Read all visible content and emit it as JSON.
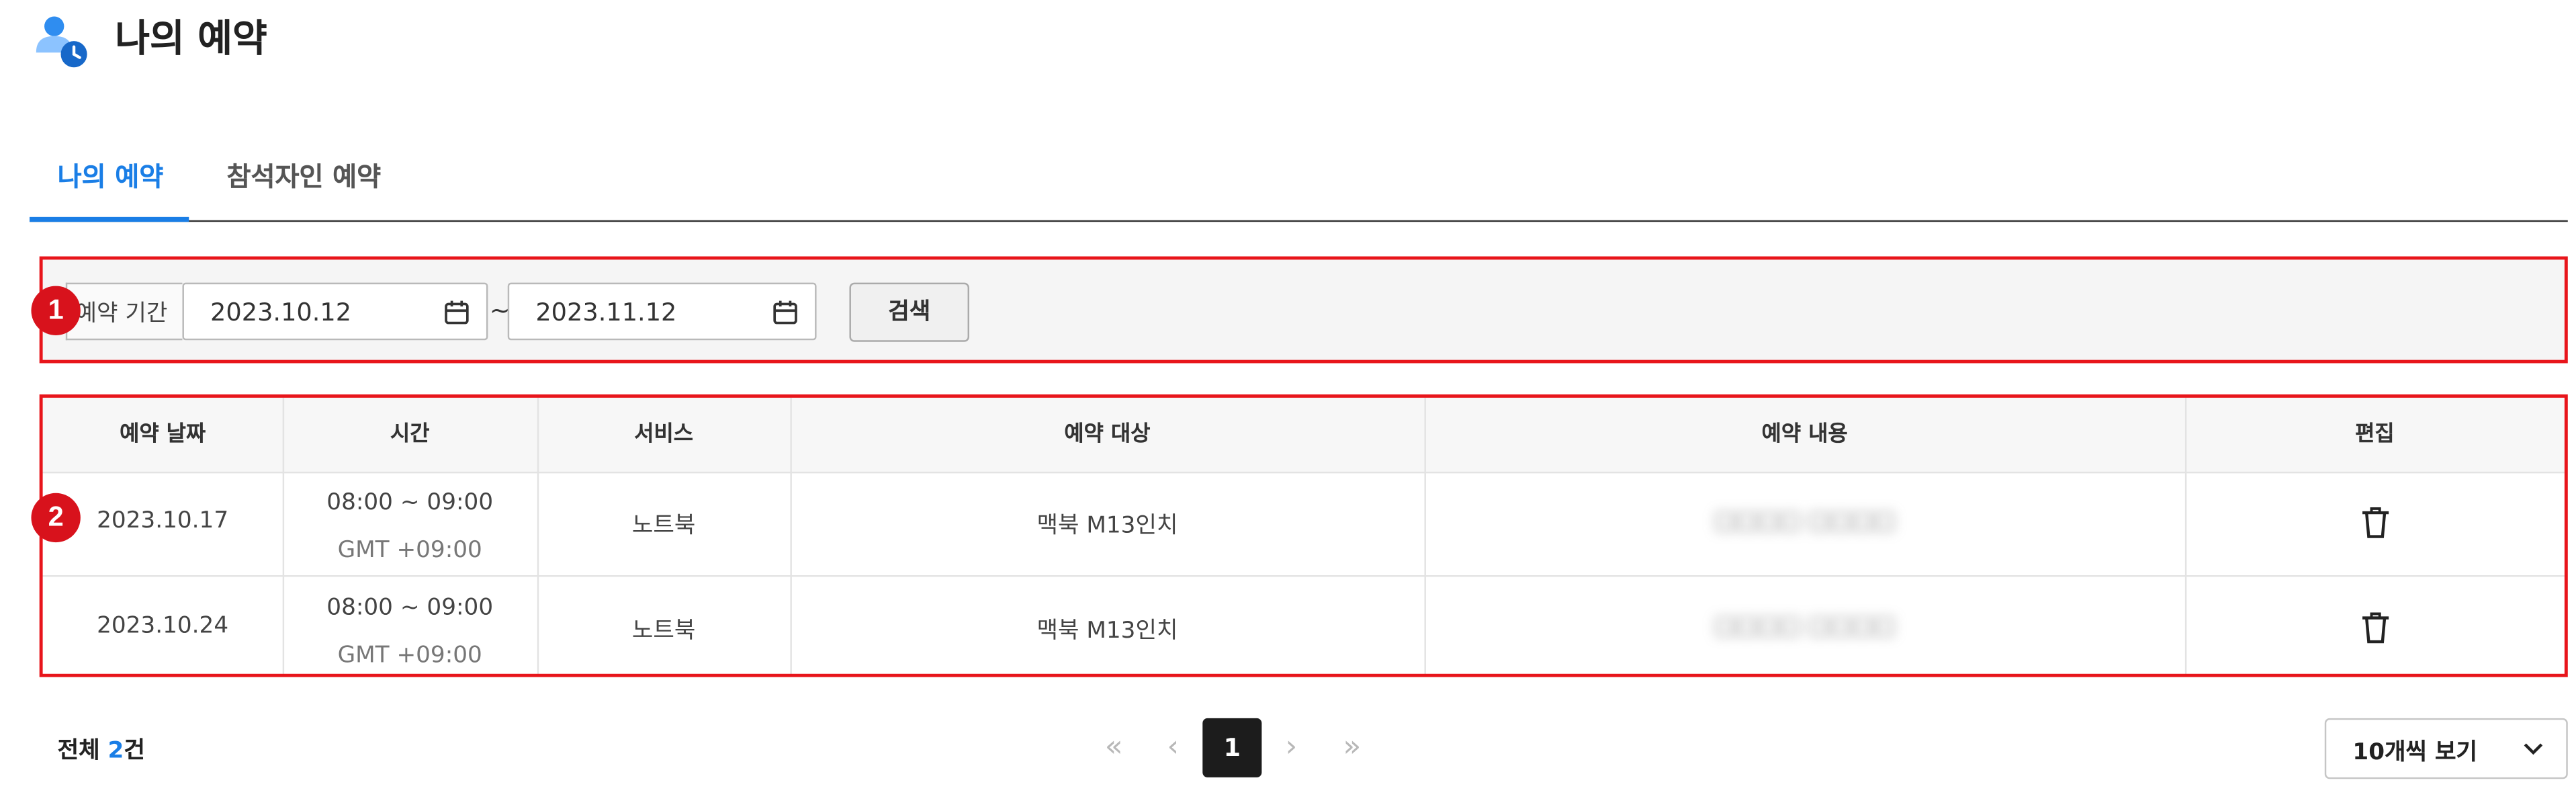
{
  "header": {
    "title": "나의 예약",
    "icon": "user-clock-icon"
  },
  "tabs": [
    {
      "label": "나의 예약",
      "active": true
    },
    {
      "label": "참석자인 예약",
      "active": false
    }
  ],
  "markers": [
    "1",
    "2"
  ],
  "filter": {
    "period_label": "예약 기간",
    "start_date": "2023.10.12",
    "separator": "~",
    "end_date": "2023.11.12",
    "search_label": "검색"
  },
  "table": {
    "headers": [
      "예약 날짜",
      "시간",
      "서비스",
      "예약 대상",
      "예약 내용",
      "편집"
    ],
    "rows": [
      {
        "date": "2023.10.17",
        "time": "08:00 ~ 09:00",
        "timezone": "GMT +09:00",
        "service": "노트북",
        "target": "맥북 M13인치",
        "content": "□□□□ □□□□",
        "action_icon": "trash-icon"
      },
      {
        "date": "2023.10.24",
        "time": "08:00 ~ 09:00",
        "timezone": "GMT +09:00",
        "service": "노트북",
        "target": "맥북 M13인치",
        "content": "□□□□ □□□□",
        "action_icon": "trash-icon"
      }
    ]
  },
  "footer": {
    "total_prefix": "전체",
    "total_count": "2",
    "total_suffix": "건",
    "pagination": {
      "first": "«",
      "prev": "‹",
      "current": "1",
      "next": "›",
      "last": "»"
    },
    "page_size_label": "10개씩 보기"
  },
  "colors": {
    "accent": "#1a7ee6",
    "annotation": "#e8151b",
    "current_page": "#1c1c1c"
  }
}
